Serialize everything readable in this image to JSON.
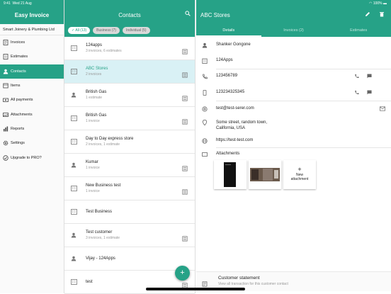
{
  "status": {
    "time": "9:41",
    "date": "Wed 21 Aug",
    "battery": "100%"
  },
  "left": {
    "title": "Easy Invoice",
    "company": "Smart Joinery & Plumbing Ltd",
    "nav": [
      {
        "label": "Invoices",
        "icon": "invoice-icon"
      },
      {
        "label": "Estimates",
        "icon": "estimate-icon"
      },
      {
        "label": "Contacts",
        "icon": "person-icon"
      },
      {
        "label": "Items",
        "icon": "items-icon"
      },
      {
        "label": "All payments",
        "icon": "payments-icon"
      },
      {
        "label": "Attachments",
        "icon": "attachment-icon"
      },
      {
        "label": "Reports",
        "icon": "reports-icon"
      },
      {
        "label": "Settings",
        "icon": "gear-icon"
      },
      {
        "label": "Upgrade to PRO?",
        "icon": "check-circle-icon"
      }
    ]
  },
  "middle": {
    "title": "Contacts",
    "filters": [
      "All (13)",
      "Business (7)",
      "Individual (5)"
    ],
    "contacts": [
      {
        "name": "124apps",
        "sub": "3 invoices, 6 estimates",
        "type": "business",
        "doc": true
      },
      {
        "name": "ABC Stores",
        "sub": "2 invoices",
        "type": "business",
        "doc": true
      },
      {
        "name": "British Gas",
        "sub": "1 estimate",
        "type": "person",
        "doc": true
      },
      {
        "name": "British Gas",
        "sub": "1 invoice",
        "type": "business",
        "doc": true
      },
      {
        "name": "Day to Day express store",
        "sub": "2 invoices, 1 estimate",
        "type": "business",
        "doc": false
      },
      {
        "name": "Kumar",
        "sub": "1 invoice",
        "type": "person",
        "doc": true
      },
      {
        "name": "New Business test",
        "sub": "1 invoice",
        "type": "business",
        "doc": true
      },
      {
        "name": "Test Business",
        "sub": "",
        "type": "business",
        "doc": false
      },
      {
        "name": "Test customer",
        "sub": "3 invoices, 1 estimate",
        "type": "person",
        "doc": true
      },
      {
        "name": "Vijay  - 124Apps",
        "sub": "",
        "type": "person",
        "doc": false
      },
      {
        "name": "test",
        "sub": "",
        "type": "business",
        "doc": true
      }
    ]
  },
  "right": {
    "title": "ABC Stores",
    "tabs": [
      "Details",
      "Invoices (2)",
      "Estimates"
    ],
    "contact_person": "Shanker Gongone",
    "company": "124Apps",
    "phone": "123456789",
    "mobile": "123234325345",
    "email": "test@test-serer.com",
    "address": "Some street, random town,\nCalifornia, USA",
    "website": "https://test-test.com",
    "attachments_title": "Attachments",
    "new_attachment": "New\nattachment",
    "statement_title": "Customer statement",
    "statement_sub": "View all transaction for this customer contact"
  },
  "colors": {
    "accent": "#26a287",
    "selected_row": "#d9f1f5"
  }
}
